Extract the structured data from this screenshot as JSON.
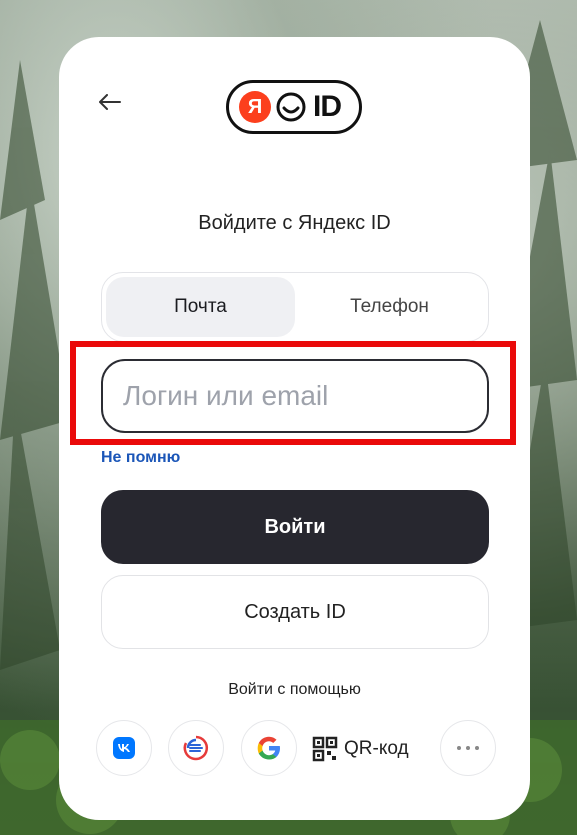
{
  "header": {
    "logo_ya": "Я",
    "logo_id": "ID"
  },
  "heading": "Войдите с Яндекс ID",
  "tabs": [
    {
      "label": "Почта",
      "active": true
    },
    {
      "label": "Телефон",
      "active": false
    }
  ],
  "login": {
    "placeholder": "Логин или email",
    "value": ""
  },
  "forgot_label": "Не помню",
  "login_button": "Войти",
  "create_button": "Создать ID",
  "alt_login_label": "Войти с помощью",
  "alt_methods": [
    {
      "name": "vk",
      "icon": "vk-icon"
    },
    {
      "name": "sber",
      "icon": "sber-icon"
    },
    {
      "name": "google",
      "icon": "google-icon"
    },
    {
      "name": "qr",
      "icon": "qr-icon",
      "label": "QR-код"
    },
    {
      "name": "more",
      "icon": "more-icon"
    }
  ],
  "colors": {
    "accent_dark": "#27272f",
    "link": "#1b56b8",
    "highlight": "#ea0a0a",
    "yandex_red": "#fc3f1d",
    "vk_blue": "#0077ff"
  }
}
